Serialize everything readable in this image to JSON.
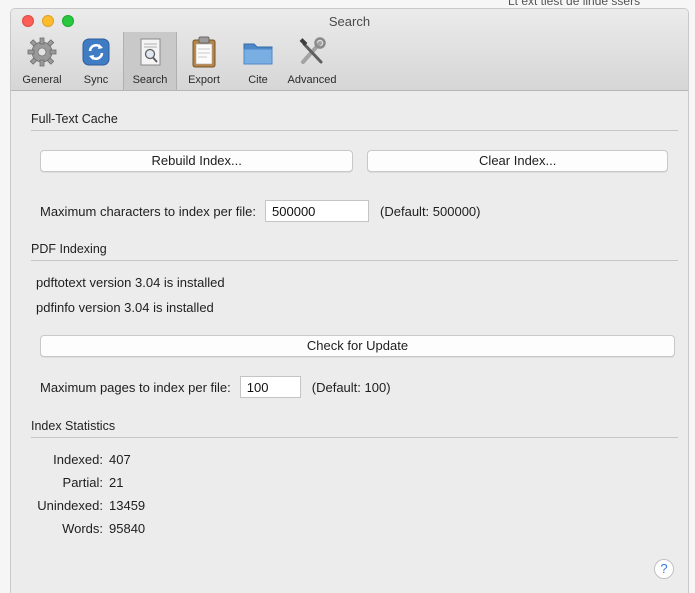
{
  "background": {
    "text": "Lt ext tiest de linde ssers"
  },
  "window": {
    "title": "Search"
  },
  "toolbar": {
    "items": [
      {
        "label": "General",
        "icon": "gear-icon"
      },
      {
        "label": "Sync",
        "icon": "sync-icon"
      },
      {
        "label": "Search",
        "icon": "search-icon"
      },
      {
        "label": "Export",
        "icon": "clipboard-icon"
      },
      {
        "label": "Cite",
        "icon": "folder-icon"
      },
      {
        "label": "Advanced",
        "icon": "tools-icon"
      }
    ],
    "active": "Search"
  },
  "fulltext_cache": {
    "header": "Full-Text Cache",
    "rebuild_label": "Rebuild Index...",
    "clear_label": "Clear Index...",
    "max_chars_label": "Maximum characters to index per file:",
    "max_chars_value": "500000",
    "max_chars_default": "(Default: 500000)"
  },
  "pdf_indexing": {
    "header": "PDF Indexing",
    "pdftotext_status": "pdftotext version 3.04 is installed",
    "pdfinfo_status": "pdfinfo version 3.04 is installed",
    "check_update_label": "Check for Update",
    "max_pages_label": "Maximum pages to index per file:",
    "max_pages_value": "100",
    "max_pages_default": "(Default: 100)"
  },
  "index_statistics": {
    "header": "Index Statistics",
    "rows": [
      {
        "label": "Indexed:",
        "value": "407"
      },
      {
        "label": "Partial:",
        "value": "21"
      },
      {
        "label": "Unindexed:",
        "value": "13459"
      },
      {
        "label": "Words:",
        "value": "95840"
      }
    ]
  },
  "help": {
    "label": "?"
  },
  "colors": {
    "window_bg": "#ececec",
    "close": "#fc5f57",
    "minimize": "#fdbc2e",
    "maximize": "#29c840",
    "help_accent": "#3a78d9"
  }
}
